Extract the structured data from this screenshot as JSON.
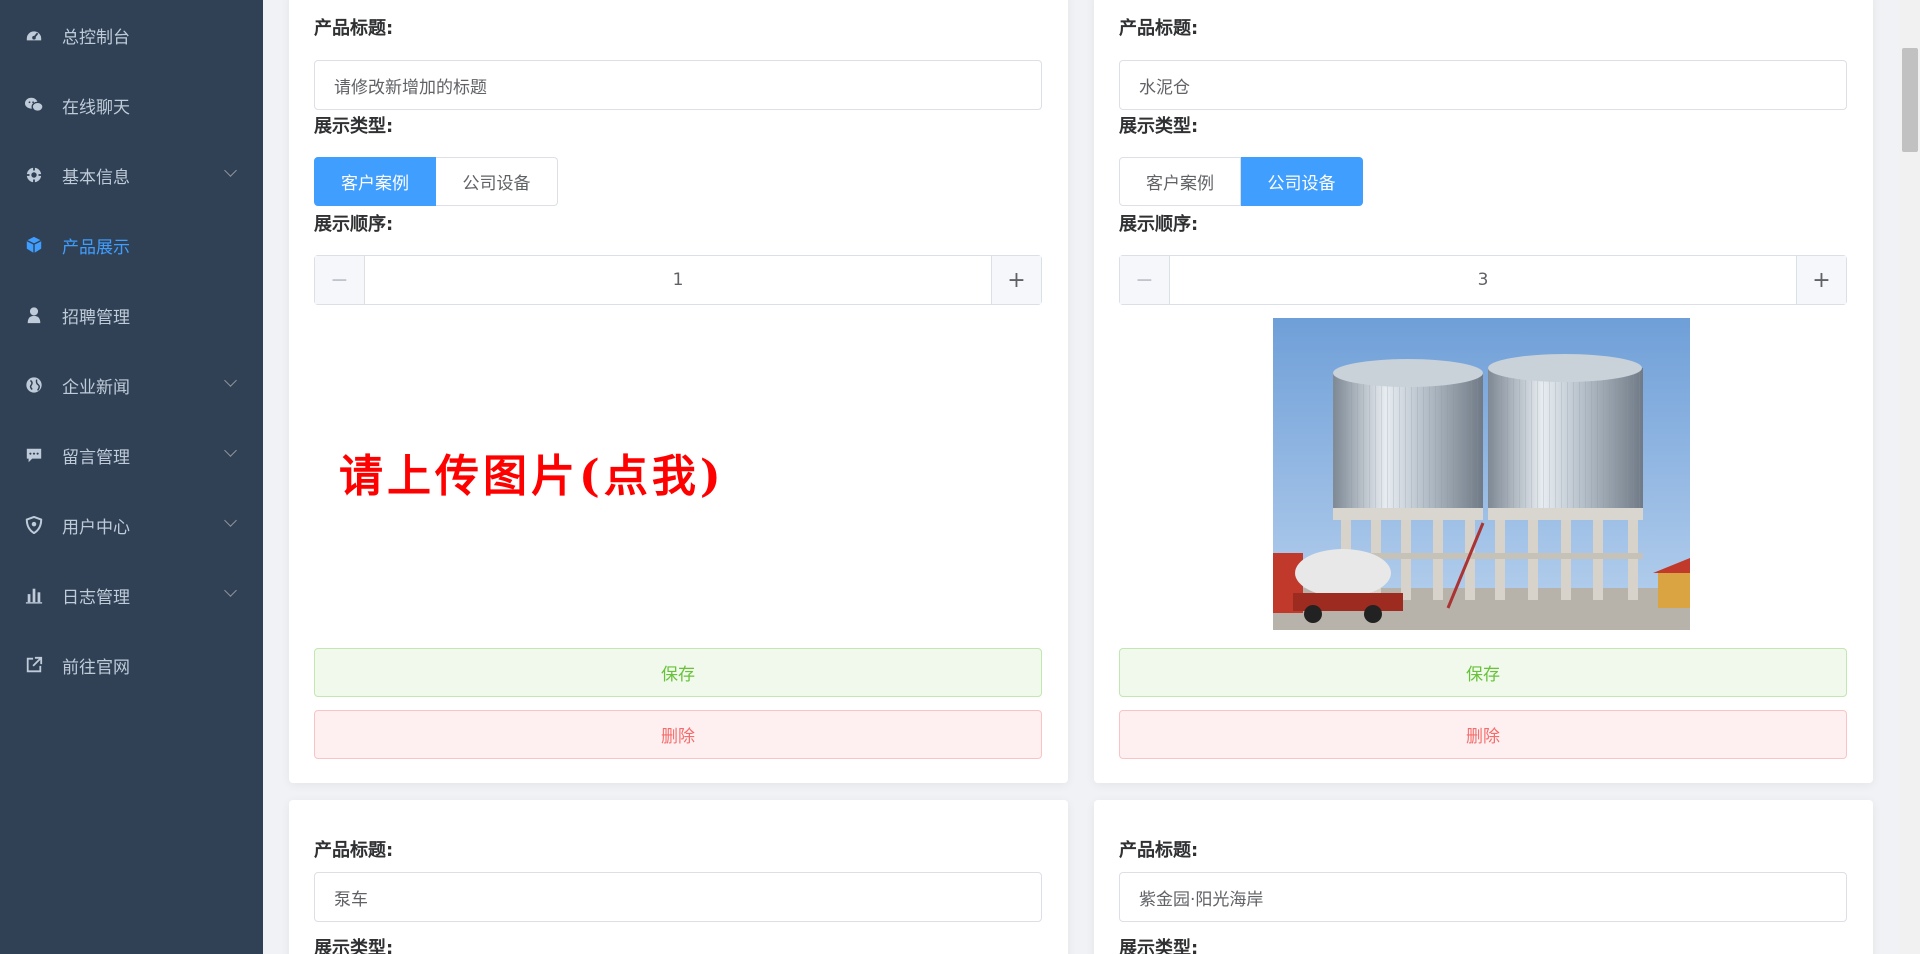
{
  "sidebar": {
    "items": [
      {
        "label": "总控制台",
        "icon": "dashboard-icon",
        "has_submenu": false,
        "active": false
      },
      {
        "label": "在线聊天",
        "icon": "wechat-icon",
        "has_submenu": false,
        "active": false
      },
      {
        "label": "基本信息",
        "icon": "settings-icon",
        "has_submenu": true,
        "active": false
      },
      {
        "label": "产品展示",
        "icon": "cube-icon",
        "has_submenu": false,
        "active": true
      },
      {
        "label": "招聘管理",
        "icon": "user-icon",
        "has_submenu": false,
        "active": false
      },
      {
        "label": "企业新闻",
        "icon": "globe-icon",
        "has_submenu": true,
        "active": false
      },
      {
        "label": "留言管理",
        "icon": "message-icon",
        "has_submenu": true,
        "active": false
      },
      {
        "label": "用户中心",
        "icon": "shield-icon",
        "has_submenu": true,
        "active": false
      },
      {
        "label": "日志管理",
        "icon": "bar-chart-icon",
        "has_submenu": true,
        "active": false
      },
      {
        "label": "前往官网",
        "icon": "external-link-icon",
        "has_submenu": false,
        "active": false
      }
    ]
  },
  "labels": {
    "title": "产品标题:",
    "type": "展示类型:",
    "order": "展示顺序:",
    "type_case": "客户案例",
    "type_equipment": "公司设备",
    "save": "保存",
    "delete": "删除",
    "minus": "−",
    "plus": "+"
  },
  "cards": [
    {
      "title_value": "请修改新增加的标题",
      "selected_type": "客户案例",
      "order": "1",
      "image": "upload-placeholder",
      "upload_text": "请上传图片(点我)"
    },
    {
      "title_value": "水泥仓",
      "selected_type": "公司设备",
      "order": "3",
      "image": "cement-silo-photo"
    },
    {
      "title_value": "泵车"
    },
    {
      "title_value": "紫金园·阳光海岸"
    }
  ],
  "colors": {
    "sidebar_bg": "#304156",
    "active": "#409eff",
    "save_green": "#67c23a",
    "delete_red": "#f56c6c",
    "upload_red": "#ff0000"
  }
}
